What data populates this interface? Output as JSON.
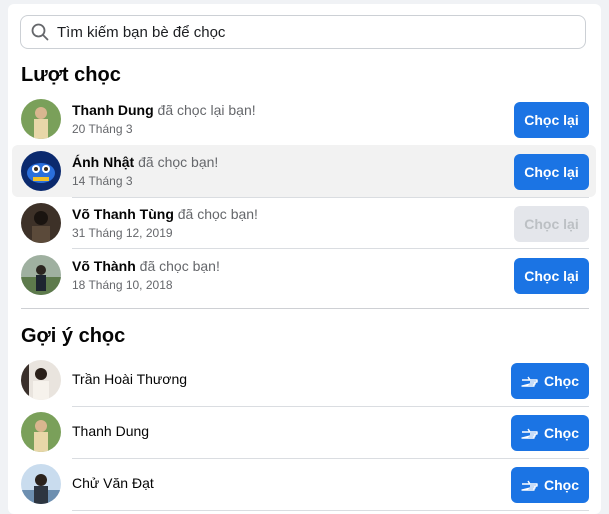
{
  "search": {
    "placeholder": "Tìm kiếm bạn bè để chọc"
  },
  "pokes_section": {
    "title": "Lượt chọc",
    "items": [
      {
        "name": "Thanh Dung",
        "action": "đã chọc lại bạn!",
        "date": "20 Tháng 3",
        "button": "Chọc lại",
        "disabled": false
      },
      {
        "name": "Ánh Nhật",
        "action": "đã chọc bạn!",
        "date": "14 Tháng 3",
        "button": "Chọc lại",
        "disabled": false
      },
      {
        "name": "Võ Thanh Tùng",
        "action": "đã chọc bạn!",
        "date": "31 Tháng 12, 2019",
        "button": "Chọc lại",
        "disabled": true
      },
      {
        "name": "Võ Thành",
        "action": "đã chọc bạn!",
        "date": "18 Tháng 10, 2018",
        "button": "Chọc lại",
        "disabled": false
      }
    ]
  },
  "suggestions_section": {
    "title": "Gợi ý chọc",
    "items": [
      {
        "name": "Trần Hoài Thương",
        "button": "Chọc"
      },
      {
        "name": "Thanh Dung",
        "button": "Chọc"
      },
      {
        "name": "Chử Văn Đạt",
        "button": "Chọc"
      }
    ]
  },
  "colors": {
    "primary": "#1b74e4",
    "disabled": "#e4e6eb",
    "secondary_text": "#65676b"
  },
  "icons": [
    "search-icon",
    "poke-hand-icon"
  ]
}
